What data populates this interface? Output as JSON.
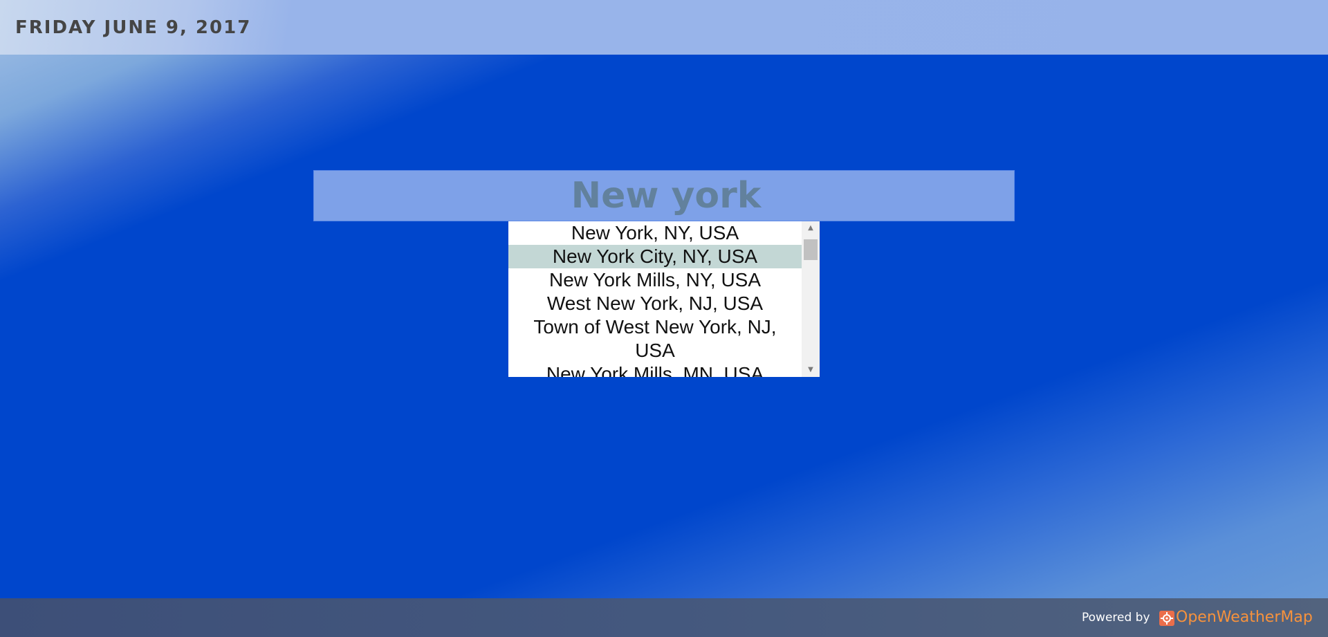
{
  "header": {
    "date": "FRIDAY JUNE 9, 2017"
  },
  "search": {
    "value": "New york"
  },
  "dropdown": {
    "items": [
      "New York, NY, USA",
      "New York City, NY, USA",
      "New York Mills, NY, USA",
      "West New York, NJ, USA",
      "Town of West New York, NJ, USA",
      "New York Mills, MN, USA"
    ],
    "selected": "New York City, NY, USA"
  },
  "footer": {
    "powered_by": "Powered by",
    "brand": "OpenWeatherMap",
    "logo_icon": "openweathermap-logo-icon"
  },
  "colors": {
    "background": "#0046cc",
    "header": "#97b3ea",
    "search_box": "#7ea1e8",
    "selected_item": "#c3d7d5",
    "footer": "#44587e",
    "brand": "#f7923c"
  }
}
